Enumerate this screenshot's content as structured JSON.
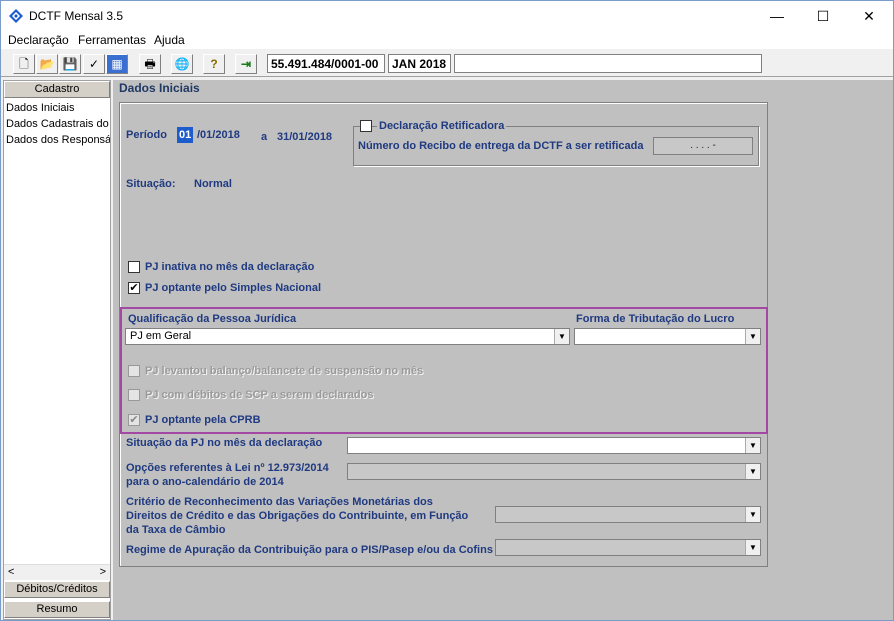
{
  "window": {
    "title": "DCTF Mensal 3.5",
    "minimize": "—",
    "maximize": "☐",
    "close": "✕"
  },
  "menu": [
    "Declaração",
    "Ferramentas",
    "Ajuda"
  ],
  "toolbar": {
    "buttons": [
      "new-file-icon",
      "open-folder-icon",
      "save-icon",
      "check-icon",
      "calc-icon",
      "print-icon",
      "globe-icon",
      "help-icon",
      "exit-icon"
    ],
    "glyphs": [
      "🗋",
      "📂",
      "💾",
      "✓",
      "▦",
      "🖶",
      "🌐",
      "?",
      "⇥"
    ],
    "cnpj": "55.491.484/0001-00",
    "period": "JAN 2018",
    "status": ""
  },
  "left_panel": {
    "header": "Cadastro",
    "items": [
      "Dados Iniciais",
      "Dados Cadastrais do E",
      "Dados dos Responsáv"
    ],
    "scroll_left": "<",
    "scroll_right": ">",
    "bottom_tabs": [
      "Débitos/Créditos",
      "Resumo"
    ]
  },
  "main": {
    "section_title": "Dados Iniciais",
    "periodo_label": "Período",
    "periodo_day": "01",
    "periodo_start_rest": "/01/2018",
    "periodo_sep": "a",
    "periodo_end": "31/01/2018",
    "retificadora_label": "Declaração Retificadora",
    "recibo_label": "Número do Recibo de entrega da DCTF a ser retificada",
    "recibo_value": ". . . . -",
    "situacao_label": "Situação:",
    "situacao_value": "Normal",
    "pj_inativa": "PJ inativa no mês da declaração",
    "pj_simples": "PJ optante pelo Simples Nacional",
    "check_mark": "✔",
    "qualificacao_label": "Qualificação da Pessoa Jurídica",
    "qualificacao_value": "PJ em Geral",
    "forma_label": "Forma de Tributação do Lucro",
    "forma_value": "",
    "pj_balanco": "PJ levantou balanço/balancete de suspensão no mês",
    "pj_scp": "PJ com débitos de SCP a serem declarados",
    "pj_cprb": "PJ optante pela CPRB",
    "situacao_pj_label": "Situação da PJ no mês da declaração",
    "opcoes_label_1": "Opções referentes à Lei nº 12.973/2014",
    "opcoes_label_2": "para o ano-calendário de 2014",
    "criterio_label_1": "Critério de Reconhecimento das Variações Monetárias dos",
    "criterio_label_2": "Direitos de Crédito e das Obrigações do Contribuinte, em Função",
    "criterio_label_3": "da Taxa de Câmbio",
    "regime_label": "Regime de Apuração da Contribuição para o PIS/Pasep e/ou da Cofins",
    "dropdown_arrow": "▼"
  }
}
